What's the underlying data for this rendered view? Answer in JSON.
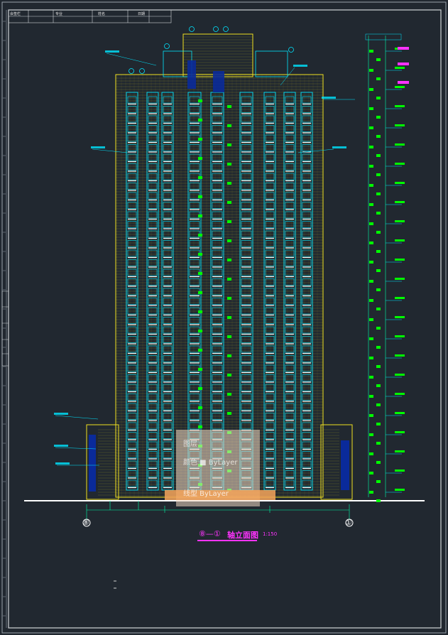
{
  "header_block": {
    "cells": [
      "会签栏",
      "专业",
      "姓名",
      "日期"
    ]
  },
  "title_block": {
    "axis_label": "⑧—①",
    "title": "轴立面图",
    "scale": "1:150"
  },
  "axis_markers": {
    "left": "⑧",
    "right": "①"
  },
  "overlay": {
    "line1": "图层",
    "line2": "颜色  ■ ByLayer",
    "line3": "线型  ByLayer"
  },
  "colors": {
    "background": "#212830",
    "frame": "#d0d4d8",
    "building_outline": "#f0e020",
    "glass": "#00e5ff",
    "elevation_marks": "#00ff00",
    "annotation_magenta": "#ff33ff",
    "dimension": "#00ffaa"
  }
}
